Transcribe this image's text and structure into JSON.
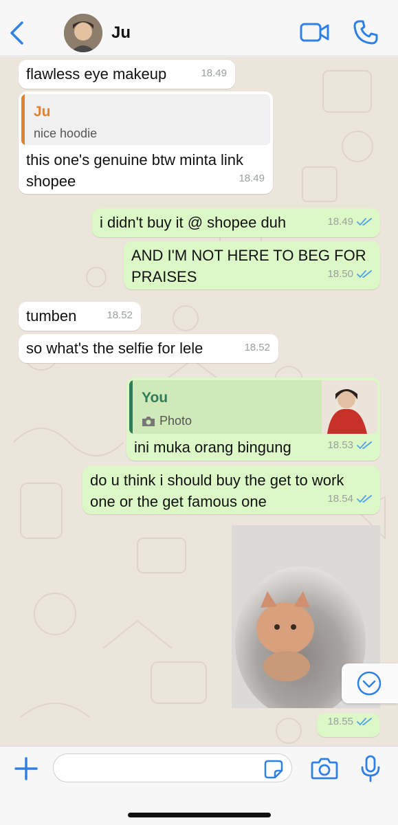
{
  "header": {
    "contact_name": "Ju",
    "back_icon": "chevron-left-icon",
    "video_icon": "video-camera-icon",
    "call_icon": "phone-icon",
    "accent_color": "#2f80e5"
  },
  "messages": [
    {
      "direction": "in",
      "text": "flawless eye makeup",
      "time": "18.49"
    },
    {
      "direction": "in",
      "quote": {
        "name": "Ju",
        "text": "nice hoodie"
      },
      "text": "this one's genuine btw minta link shopee",
      "time": "18.49"
    },
    {
      "direction": "out",
      "text": "i didn't buy it @ shopee duh",
      "time": "18.49",
      "status": "read"
    },
    {
      "direction": "out",
      "text": "AND I'M NOT HERE TO BEG FOR PRAISES",
      "time": "18.50",
      "status": "read"
    },
    {
      "direction": "in",
      "text": "tumben",
      "time": "18.52"
    },
    {
      "direction": "in",
      "text": "so what's the selfie for lele",
      "time": "18.52"
    },
    {
      "direction": "out",
      "quote": {
        "name": "You",
        "text": "Photo",
        "icon": "camera-icon"
      },
      "text": "ini muka orang bingung",
      "time": "18.53",
      "status": "read"
    },
    {
      "direction": "out",
      "text": "do u think i should buy the get to work one or the get famous one",
      "time": "18.54",
      "status": "read"
    },
    {
      "direction": "out",
      "type": "image",
      "time": "18.55",
      "status": "read"
    }
  ],
  "colors": {
    "incoming_bubble": "#ffffff",
    "outgoing_bubble": "#dcf8c6",
    "chat_background": "#ece5dc",
    "quote_in_name": "#e0822f",
    "quote_out_name": "#2f7b5a",
    "read_ticks": "#4fa3e6"
  },
  "input_bar": {
    "placeholder": "",
    "plus_icon": "plus-icon",
    "sticker_icon": "sticker-icon",
    "camera_icon": "camera-icon",
    "mic_icon": "microphone-icon"
  },
  "scroll_button_icon": "chevron-down-circle-icon"
}
